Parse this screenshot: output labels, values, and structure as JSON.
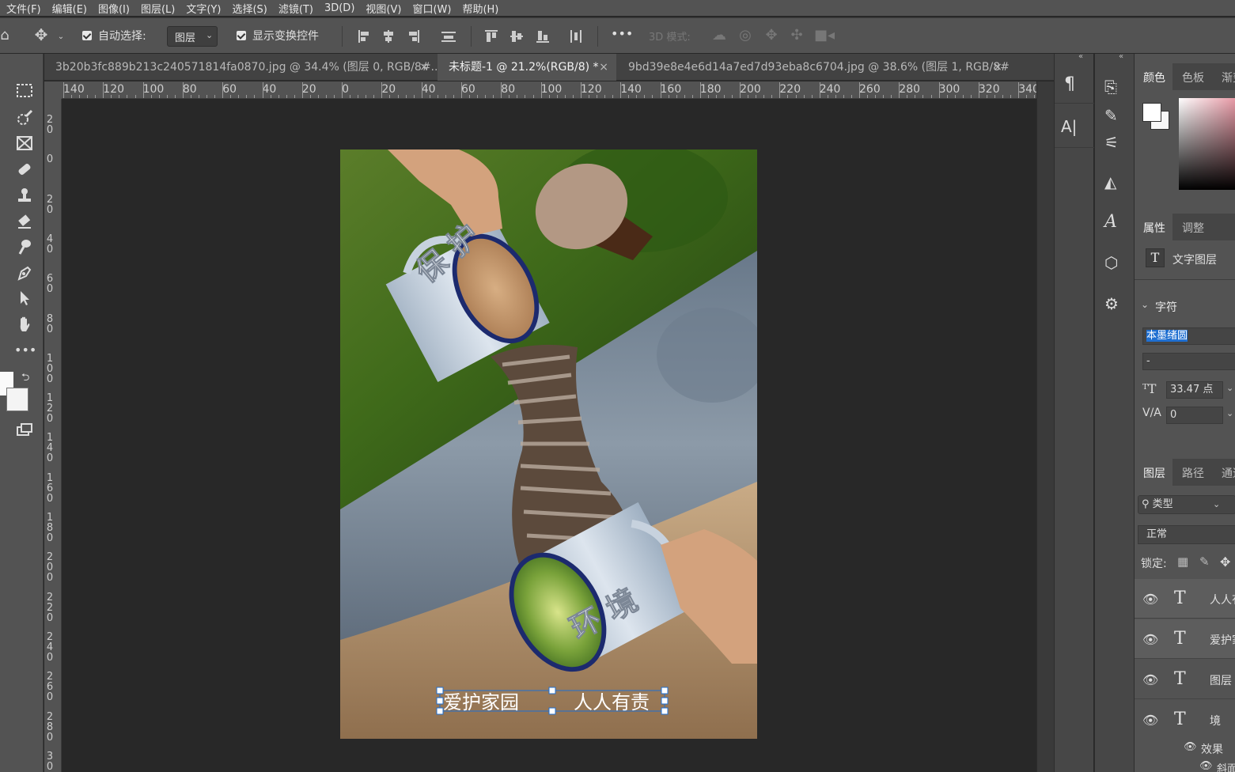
{
  "menu": [
    "文件(F)",
    "编辑(E)",
    "图像(I)",
    "图层(L)",
    "文字(Y)",
    "选择(S)",
    "滤镜(T)",
    "3D(D)",
    "视图(V)",
    "窗口(W)",
    "帮助(H)"
  ],
  "options": {
    "auto_select_label": "自动选择:",
    "auto_select_value": "图层",
    "show_transform_label": "显示变换控件",
    "more": "•••",
    "mode_3d_label": "3D 模式:"
  },
  "tabs": [
    {
      "label": "3b20b3fc889b213c240571814fa0870.jpg @ 34.4% (图层 0, RGB/8#...",
      "active": false
    },
    {
      "label": "未标题-1 @ 21.2%(RGB/8) *",
      "active": true
    },
    {
      "label": "9bd39e8e4e6d14a7ed7d93eba8c6704.jpg @ 38.6% (图层 1, RGB/8#...",
      "active": false
    }
  ],
  "ruler_h": [
    "140",
    "120",
    "100",
    "80",
    "60",
    "40",
    "20",
    "0",
    "20",
    "40",
    "60",
    "80",
    "100",
    "120",
    "140",
    "160",
    "180",
    "200",
    "220",
    "240",
    "260",
    "280",
    "300",
    "320",
    "340"
  ],
  "ruler_v": [
    "2 0",
    "0",
    "2 0",
    "4 0",
    "6 0",
    "8 0",
    "1 0 0",
    "1 2 0",
    "1 4 0",
    "1 6 0",
    "1 8 0",
    "2 0 0",
    "2 2 0",
    "2 4 0",
    "2 6 0",
    "2 8 0",
    "3 0"
  ],
  "poster": {
    "top_cup_text": "保 护",
    "bottom_cup_text": "环 境",
    "caption_left": "爱护家园",
    "caption_right": "人人有责"
  },
  "panel": {
    "color_tabs": [
      "颜色",
      "色板",
      "渐变"
    ],
    "props_tabs": [
      "属性",
      "调整"
    ],
    "text_layer_label": "文字图层",
    "char_section": "字符",
    "font_name": "本墨绪圆",
    "font_style": "-",
    "font_size": "33.47 点",
    "tracking": "0",
    "layers_tabs": [
      "图层",
      "路径",
      "通道"
    ],
    "filter_label": "类型",
    "blend_mode": "正常",
    "lock_label": "锁定:",
    "layers": [
      {
        "name": "人人有责",
        "selected": true
      },
      {
        "name": "爱护家园",
        "selected": true
      },
      {
        "name": "图层",
        "selected": false
      },
      {
        "name": "境",
        "selected": false
      }
    ],
    "effects_label": "效果",
    "sub_effect": "斜面"
  },
  "colors": {
    "selection_blue": "#1f6fd1",
    "cup_rim": "#1c2a6e"
  }
}
